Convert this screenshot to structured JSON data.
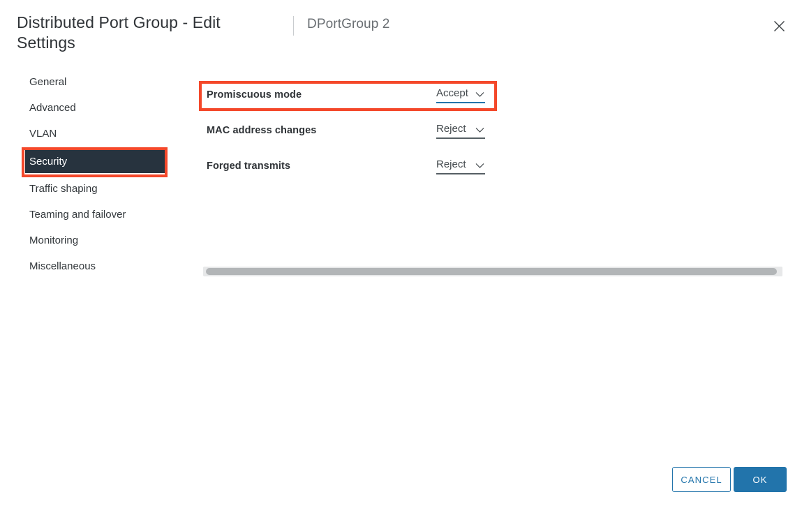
{
  "header": {
    "title": "Distributed Port Group - Edit Settings",
    "subtitle": "DPortGroup 2",
    "close_icon": "close-icon"
  },
  "sidebar": {
    "items": [
      {
        "label": "General",
        "selected": false
      },
      {
        "label": "Advanced",
        "selected": false
      },
      {
        "label": "VLAN",
        "selected": false
      },
      {
        "label": "Security",
        "selected": true
      },
      {
        "label": "Traffic shaping",
        "selected": false
      },
      {
        "label": "Teaming and failover",
        "selected": false
      },
      {
        "label": "Monitoring",
        "selected": false
      },
      {
        "label": "Miscellaneous",
        "selected": false
      }
    ]
  },
  "main": {
    "fields": [
      {
        "label": "Promiscuous mode",
        "value": "Accept",
        "options": [
          "Accept",
          "Reject"
        ],
        "focused": true,
        "chevron_icon": "chevron-down-icon"
      },
      {
        "label": "MAC address changes",
        "value": "Reject",
        "options": [
          "Accept",
          "Reject"
        ],
        "focused": false,
        "chevron_icon": "chevron-down-icon"
      },
      {
        "label": "Forged transmits",
        "value": "Reject",
        "options": [
          "Accept",
          "Reject"
        ],
        "focused": false,
        "chevron_icon": "chevron-down-icon"
      }
    ]
  },
  "footer": {
    "cancel_label": "CANCEL",
    "ok_label": "OK"
  },
  "colors": {
    "accent_blue": "#2274ab",
    "selected_nav_bg": "#27333e",
    "annotation_red": "#f4482a",
    "scrollbar_thumb": "#b2b5b7",
    "scrollbar_track": "#e7e8e9",
    "underline_gray": "#565f64"
  },
  "annotations": [
    {
      "target": "sidebar-item-security",
      "color": "#f4482a"
    },
    {
      "target": "field-row-promiscuous-mode",
      "color": "#f4482a"
    }
  ]
}
